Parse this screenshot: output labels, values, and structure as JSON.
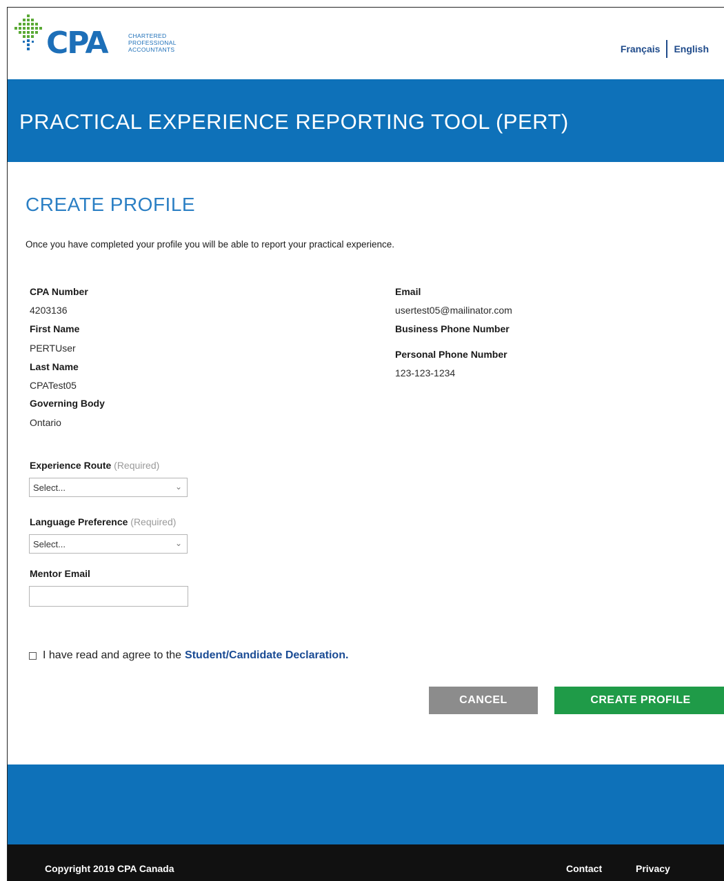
{
  "header": {
    "logo_text": "CPA",
    "logo_subtitle": [
      "CHARTERED",
      "PROFESSIONAL",
      "ACCOUNTANTS"
    ],
    "languages": [
      "Français",
      "English"
    ],
    "brand_color": "#0e71b9"
  },
  "banner": {
    "title": "PRACTICAL EXPERIENCE REPORTING TOOL (PERT)"
  },
  "page": {
    "title": "CREATE PROFILE",
    "intro": "Once you have completed your profile you will be able to report your practical experience."
  },
  "profile": {
    "cpa_number": {
      "label": "CPA Number",
      "value": "4203136"
    },
    "first_name": {
      "label": "First Name",
      "value": "PERTUser"
    },
    "last_name": {
      "label": "Last Name",
      "value": "CPATest05"
    },
    "governing_body": {
      "label": "Governing Body",
      "value": "Ontario"
    },
    "email": {
      "label": "Email",
      "value": "usertest05@mailinator.com"
    },
    "business_phone": {
      "label": "Business Phone Number",
      "value": ""
    },
    "personal_phone": {
      "label": "Personal Phone Number",
      "value": "123-123-1234"
    }
  },
  "form": {
    "experience_route": {
      "label": "Experience Route",
      "required": "(Required)",
      "selected": "Select..."
    },
    "language_preference": {
      "label": "Language Preference",
      "required": "(Required)",
      "selected": "Select..."
    },
    "mentor_email": {
      "label": "Mentor Email",
      "value": ""
    },
    "declaration": {
      "text": "I have read and agree to the",
      "link": "Student/Candidate Declaration."
    }
  },
  "buttons": {
    "cancel": "CANCEL",
    "create": "CREATE PROFILE"
  },
  "footer": {
    "copyright": "Copyright 2019 CPA Canada",
    "contact": "Contact",
    "privacy": "Privacy"
  }
}
